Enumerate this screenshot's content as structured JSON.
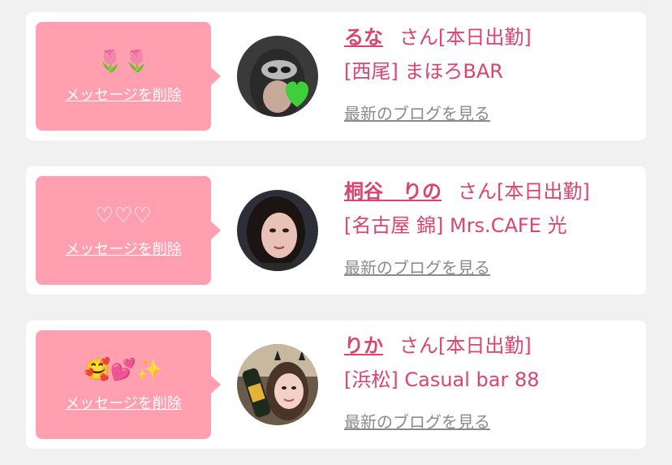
{
  "cards": [
    {
      "message": "🌷🌷",
      "delete_label": "メッセージを削除",
      "name": "るな",
      "honorific_status": "さん[本日出勤]",
      "shop": "[西尾] まほろBAR",
      "blog_link": "最新のブログを見る",
      "avatar_icon": "masked-woman-with-green-heart-avatar"
    },
    {
      "message": "♡♡♡",
      "delete_label": "メッセージを削除",
      "name": "桐谷　りの",
      "honorific_status": "さん[本日出勤]",
      "shop": "[名古屋 錦] Mrs.CAFE 光",
      "blog_link": "最新のブログを見る",
      "avatar_icon": "woman-portrait-avatar"
    },
    {
      "message": "🥰💕✨",
      "delete_label": "メッセージを削除",
      "name": "りか",
      "honorific_status": "さん[本日出勤]",
      "shop": "[浜松] Casual bar 88",
      "blog_link": "最新のブログを見る",
      "avatar_icon": "woman-with-bottle-avatar"
    }
  ],
  "colors": {
    "bubble": "#ff9fb0",
    "name_pink": "#d9456d",
    "link_gray": "#8b8b8b",
    "page_bg": "#f1f1f1",
    "card_bg": "#ffffff"
  }
}
